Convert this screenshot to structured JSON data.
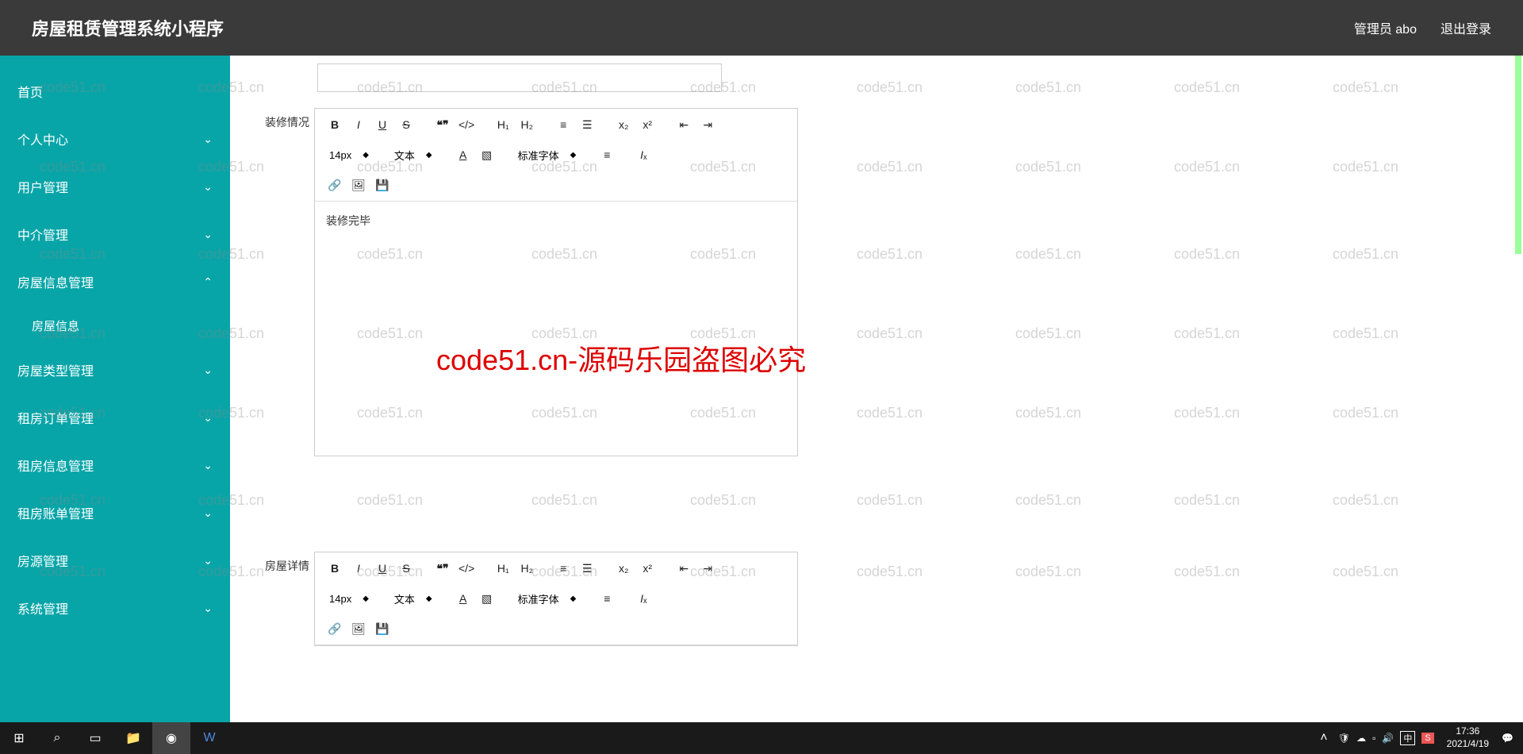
{
  "header": {
    "title": "房屋租赁管理系统小程序",
    "user_label": "管理员 abo",
    "logout": "退出登录"
  },
  "sidebar": {
    "items": [
      {
        "label": "首页",
        "expand": false,
        "chev": ""
      },
      {
        "label": "个人中心",
        "expand": false,
        "chev": "⌄"
      },
      {
        "label": "用户管理",
        "expand": false,
        "chev": "⌄"
      },
      {
        "label": "中介管理",
        "expand": false,
        "chev": "⌄"
      },
      {
        "label": "房屋信息管理",
        "expand": true,
        "chev": "⌃"
      },
      {
        "label": "房屋类型管理",
        "expand": false,
        "chev": "⌄"
      },
      {
        "label": "租房订单管理",
        "expand": false,
        "chev": "⌄"
      },
      {
        "label": "租房信息管理",
        "expand": false,
        "chev": "⌄"
      },
      {
        "label": "租房账单管理",
        "expand": false,
        "chev": "⌄"
      },
      {
        "label": "房源管理",
        "expand": false,
        "chev": "⌄"
      },
      {
        "label": "系统管理",
        "expand": false,
        "chev": "⌄"
      }
    ],
    "subitem": "房屋信息"
  },
  "form": {
    "label1": "装修情况",
    "label2": "房屋详情",
    "editor1_content": "装修完毕",
    "toolbar": {
      "fontsize": "14px",
      "texttype": "文本",
      "fontfamily": "标准字体"
    }
  },
  "watermark_text": "code51.cn",
  "big_watermark": "code51.cn-源码乐园盗图必究",
  "taskbar": {
    "time": "17:36",
    "date": "2021/4/19",
    "ime": "中"
  }
}
